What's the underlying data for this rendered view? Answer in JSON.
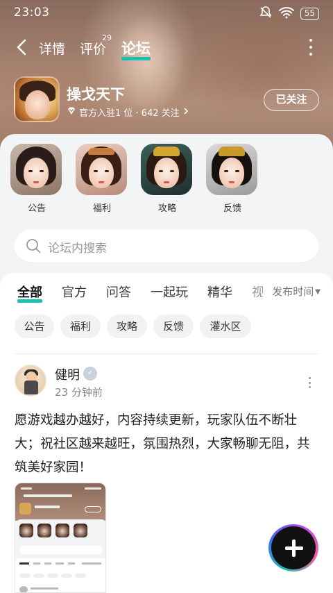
{
  "status": {
    "time": "23:03",
    "battery": "55"
  },
  "nav": {
    "tabs": [
      {
        "label": "详情"
      },
      {
        "label": "评价",
        "count": "29"
      },
      {
        "label": "论坛"
      }
    ]
  },
  "game": {
    "name": "操戈天下",
    "meta": "官方入驻1 位 · 642 关注",
    "follow_label": "已关注"
  },
  "categories": [
    {
      "label": "公告"
    },
    {
      "label": "福利"
    },
    {
      "label": "攻略"
    },
    {
      "label": "反馈"
    }
  ],
  "search": {
    "placeholder": "论坛内搜索"
  },
  "filter_tabs": [
    {
      "label": "全部"
    },
    {
      "label": "官方"
    },
    {
      "label": "问答"
    },
    {
      "label": "一起玩"
    },
    {
      "label": "精华"
    },
    {
      "label": "视"
    }
  ],
  "sort": {
    "label": "发布时间"
  },
  "chips": [
    {
      "label": "公告"
    },
    {
      "label": "福利"
    },
    {
      "label": "攻略"
    },
    {
      "label": "反馈"
    },
    {
      "label": "灌水区"
    }
  ],
  "post": {
    "username": "健明",
    "time": "23 分钟前",
    "content": "愿游戏越办越好，内容持续更新，玩家队伍不断壮大；祝社区越来越旺，氛围热烈，大家畅聊无阻，共筑美好家园！"
  },
  "colors": {
    "accent": "#19c1b2"
  }
}
